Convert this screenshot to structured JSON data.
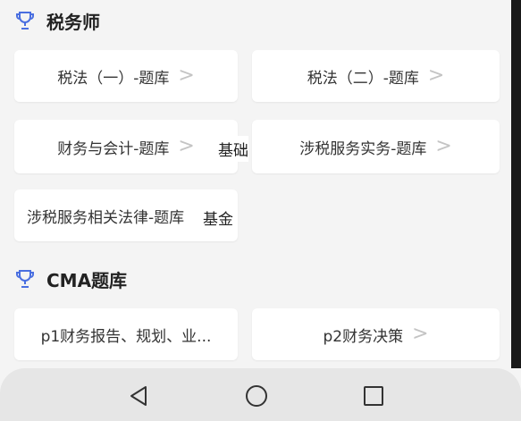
{
  "sections": [
    {
      "title": "税务师",
      "icon": "trophy-icon",
      "cards": [
        {
          "label": "税法（一）-题库",
          "chevron": ">"
        },
        {
          "label": "税法（二）-题库",
          "chevron": ">"
        },
        {
          "label": "财务与会计-题库",
          "chevron": ">"
        },
        {
          "label": "涉税服务实务-题库",
          "chevron": ">"
        },
        {
          "label": "涉税服务相关法律-题库"
        }
      ]
    },
    {
      "title": "CMA题库",
      "icon": "trophy-icon",
      "cards": [
        {
          "label": "p1财务报告、规划、业..."
        },
        {
          "label": "p2财务决策",
          "chevron": ">"
        }
      ]
    }
  ],
  "overlays": {
    "jichu": "基础",
    "jijin": "基金"
  },
  "navbar": {
    "back": "back-triangle-icon",
    "home": "home-circle-icon",
    "recents": "recents-square-icon"
  },
  "colors": {
    "icon_blue": "#4a6fe0",
    "background": "#f4f4f4",
    "card": "#ffffff"
  }
}
